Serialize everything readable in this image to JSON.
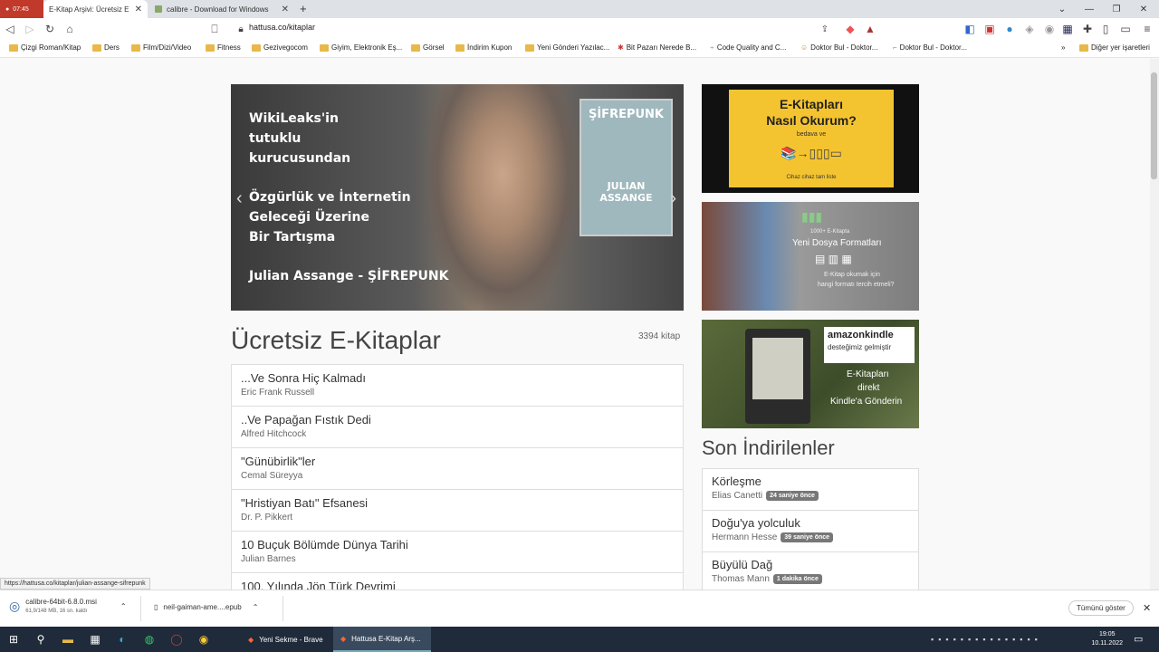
{
  "browser": {
    "recording": "07:45",
    "tabs": [
      {
        "title": "E-Kitap Arşivi: Ücretsiz E"
      },
      {
        "title": "calibre - Download for Windows"
      }
    ],
    "new_tab": "+",
    "url": "hattusa.co/kitaplar",
    "bookmarks": [
      "Çizgi Roman/Kitap",
      "Ders",
      "Film/Dizi/Video",
      "Fitness",
      "Gezivegocom",
      "Giyim, Elektronik Eş...",
      "Görsel",
      "İndirim Kupon",
      "Yeni Gönderi Yazılac...",
      "Bit Pazarı Nerede B...",
      "Code Quality and C...",
      "Doktor Bul - Doktor...",
      "Doktor Bul - Doktor..."
    ],
    "other_bookmarks": "Diğer yer işaretleri"
  },
  "hero": {
    "lines": [
      "WikiLeaks'in",
      "tutuklu",
      "kurucusundan"
    ],
    "lines2": [
      "Özgürlük ve İnternetin",
      "Geleceği Üzerine",
      "Bir Tartışma"
    ],
    "author_line": "Julian Assange - ŞİFREPUNK",
    "cover_title": "ŞİFREPUNK",
    "cover_author": "JULIAN ASSANGE"
  },
  "main": {
    "heading": "Ücretsiz E-Kitaplar",
    "count": "3394 kitap",
    "books": [
      {
        "title": "...Ve Sonra Hiç Kalmadı",
        "author": "Eric Frank Russell"
      },
      {
        "title": "..Ve Papağan Fıstık Dedi",
        "author": "Alfred Hitchcock"
      },
      {
        "title": "\"Günübirlik\"ler",
        "author": "Cemal Süreyya"
      },
      {
        "title": "\"Hristiyan Batı\" Efsanesi",
        "author": "Dr. P. Pikkert"
      },
      {
        "title": "10 Buçuk Bölümde Dünya Tarihi",
        "author": "Julian Barnes"
      },
      {
        "title": "100. Yılında Jön Türk Devrimi",
        "author": ""
      }
    ]
  },
  "promos": {
    "p1": {
      "line1": "E-Kitapları",
      "line2": "Nasıl Okurum?",
      "line3": "bedava ve",
      "line4": "Cihaz cihaz tam liste"
    },
    "p2": {
      "line1": "1000+ E-Kitapta",
      "line2": "Yeni Dosya Formatları",
      "line3": "E-Kitap okumak için",
      "line4": "hangi formatı tercih etmeli?"
    },
    "p3": {
      "brand": "amazonkindle",
      "line1": "desteğimiz gelmiştir",
      "line2": "E-Kitapları",
      "line3": "direkt",
      "line4": "Kindle'a Gönderin"
    }
  },
  "recent": {
    "title": "Son İndirilenler",
    "items": [
      {
        "title": "Körleşme",
        "author": "Elias Canetti",
        "time": "24 saniye önce"
      },
      {
        "title": "Doğu'ya yolculuk",
        "author": "Hermann Hesse",
        "time": "39 saniye önce"
      },
      {
        "title": "Büyülü Dağ",
        "author": "Thomas Mann",
        "time": "1 dakika önce"
      }
    ]
  },
  "status_url": "https://hattusa.co/kitaplar/julian-assange-sifrepunk",
  "downloads": {
    "items": [
      {
        "name": "calibre-64bit-6.8.0.msi",
        "progress_text": "61,9/148 MB, 16 sn. kaldı"
      },
      {
        "name": "neil-gaiman-ame....epub",
        "progress_text": ""
      }
    ],
    "show_all": "Tümünü göster"
  },
  "taskbar": {
    "apps": [
      "Yeni Sekme - Brave",
      "Hattusa E-Kitap Arş..."
    ],
    "time": "19:05",
    "date": "10.11.2022"
  }
}
